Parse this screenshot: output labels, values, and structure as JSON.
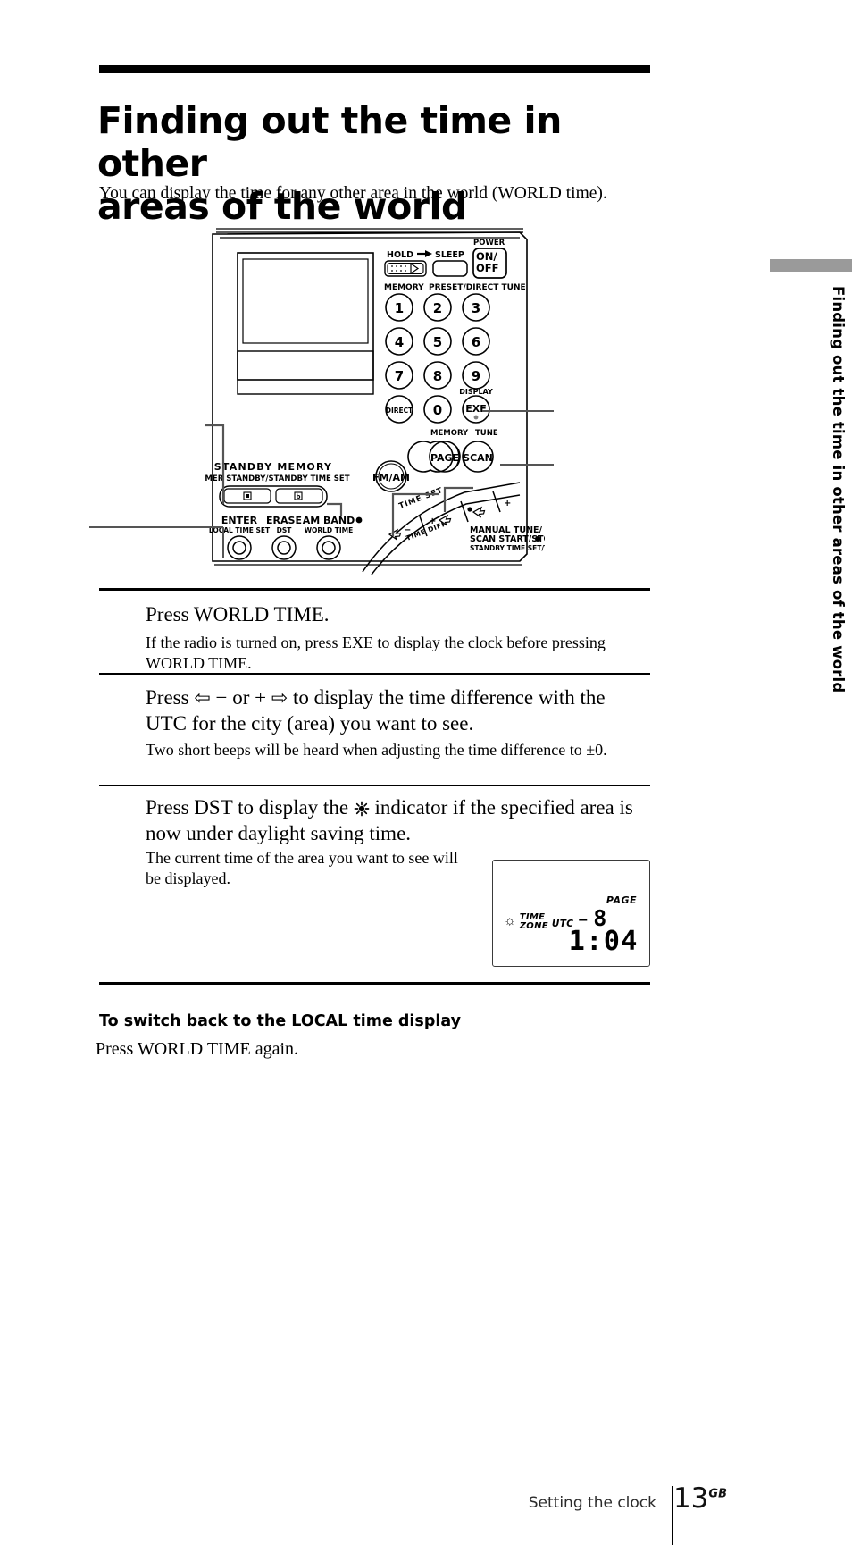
{
  "header": {
    "title_line1": "Finding out the time in other",
    "title_line2": "areas of the world",
    "intro": "You can display the time for any other area in the world (WORLD time)."
  },
  "side_tab": {
    "label": "Finding out the time in other areas of the world"
  },
  "illustration": {
    "name": "sony-world-band-radio-front-panel",
    "labels": {
      "hold": "HOLD",
      "sleep": "SLEEP",
      "power": "POWER",
      "power_on": "ON/",
      "power_off": "OFF",
      "memory": "MEMORY",
      "preset_direct_tune": "PRESET/DIRECT TUNE",
      "keys": [
        "1",
        "2",
        "3",
        "4",
        "5",
        "6",
        "7",
        "8",
        "9",
        "0"
      ],
      "direct": "DIRECT",
      "display": "DISPLAY",
      "exe": "EXE",
      "memory2": "MEMORY",
      "tune": "TUNE",
      "page": "PAGE",
      "scan": "SCAN",
      "fm_am": "FM/AM",
      "standby_memory": "STANDBY  MEMORY",
      "timer_standby": "TIMER STANDBY/STANDBY TIME SET",
      "enter": "ENTER",
      "local_time_set": "LOCAL TIME SET",
      "erase": "ERASE",
      "dst": "DST",
      "am_band": "AM BAND",
      "world_time": "WORLD TIME",
      "time_set": "TIME SET",
      "time_diff": "TIME DIFF",
      "manual_tune": "MANUAL TUNE/",
      "scan_start_stop": "SCAN START/STOP",
      "standby_time_set": "STANDBY TIME SET/TIME SET",
      "minus": "−",
      "plus": "+"
    }
  },
  "steps": [
    {
      "head": "Press WORLD TIME.",
      "body": "If the radio is turned on, press EXE to display the clock before pressing WORLD TIME."
    },
    {
      "head_pre": "Press ",
      "head_arrow_left": "⇦",
      "head_mid1": " − or + ",
      "head_arrow_right": "⇨",
      "head_post": " to display the time difference with the UTC for the city (area) you want to see.",
      "body": "Two short beeps will be heard when adjusting the time difference to ±0."
    },
    {
      "head_pre": "Press DST to display the ",
      "head_icon": "sun-indicator",
      "head_post": " indicator if the specified area is now under daylight saving time.",
      "body": "The current time of the area you want to see will be displayed."
    }
  ],
  "lcd": {
    "page_label": "PAGE",
    "sun_icon": "☼",
    "time_label_line1": "TIME",
    "time_label_line2": "ZONE",
    "utc_label": "UTC",
    "sign": "–",
    "offset": "8",
    "time": "1:04"
  },
  "footer_section": {
    "subhead": "To switch back to the LOCAL time display",
    "subtext": "Press WORLD TIME again."
  },
  "page_footer": {
    "chapter": "Setting the clock",
    "page_number": "13",
    "page_suffix": "GB"
  }
}
